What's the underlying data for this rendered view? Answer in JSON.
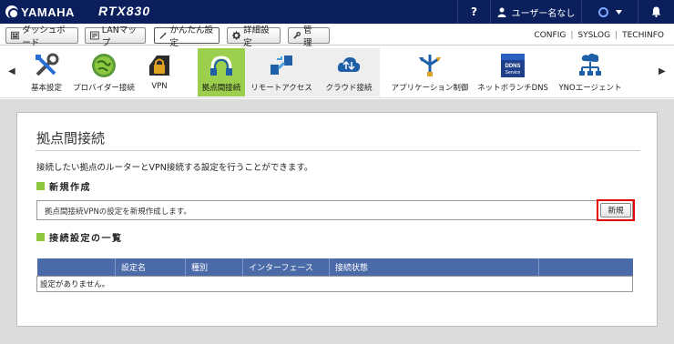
{
  "header": {
    "brand": "YAMAHA",
    "model": "RTX830",
    "help_label": "?",
    "user_label": "ユーザー名なし"
  },
  "menu": {
    "buttons": [
      {
        "label": "ダッシュボード",
        "icon": "dashboard-icon"
      },
      {
        "label": "LANマップ",
        "icon": "lan-map-icon"
      },
      {
        "label": "かんたん設定",
        "icon": "wand-icon"
      },
      {
        "label": "詳細設定",
        "icon": "gear-icon"
      },
      {
        "label": "管　理",
        "icon": "wrench-icon"
      }
    ],
    "links": [
      "CONFIG",
      "SYSLOG",
      "TECHINFO"
    ]
  },
  "nav": {
    "items": [
      {
        "label": "基本設定",
        "icon": "tools-icon"
      },
      {
        "label": "プロバイダー接続",
        "icon": "globe-icon"
      },
      {
        "label": "VPN",
        "icon": "vpn-lock-icon"
      },
      {
        "label": "拠点間接続",
        "icon": "site-connection-icon"
      },
      {
        "label": "リモートアクセス",
        "icon": "remote-access-icon"
      },
      {
        "label": "クラウド接続",
        "icon": "cloud-connection-icon"
      },
      {
        "label": "アプリケーション制御",
        "icon": "application-control-icon"
      },
      {
        "label": "ネットボランチDNS",
        "icon": "ddns-service-icon"
      },
      {
        "label": "YNOエージェント",
        "icon": "yno-agent-icon"
      }
    ],
    "ddns_badge": "DDNS\nService"
  },
  "page": {
    "title": "拠点間接続",
    "description": "接続したい拠点のルーターとVPN接続する設定を行うことができます。",
    "section_new": "新規作成",
    "new_text": "拠点間接続VPNの設定を新規作成します。",
    "new_button": "新規",
    "section_list": "接続設定の一覧",
    "table": {
      "columns": [
        "設定名",
        "種別",
        "インターフェース",
        "接続状態"
      ],
      "empty_text": "設定がありません。"
    }
  },
  "colors": {
    "header_bg": "#0b1f5c",
    "selected_nav": "#9ccf4e",
    "table_header": "#4a6aa8",
    "highlight": "#e60000"
  }
}
